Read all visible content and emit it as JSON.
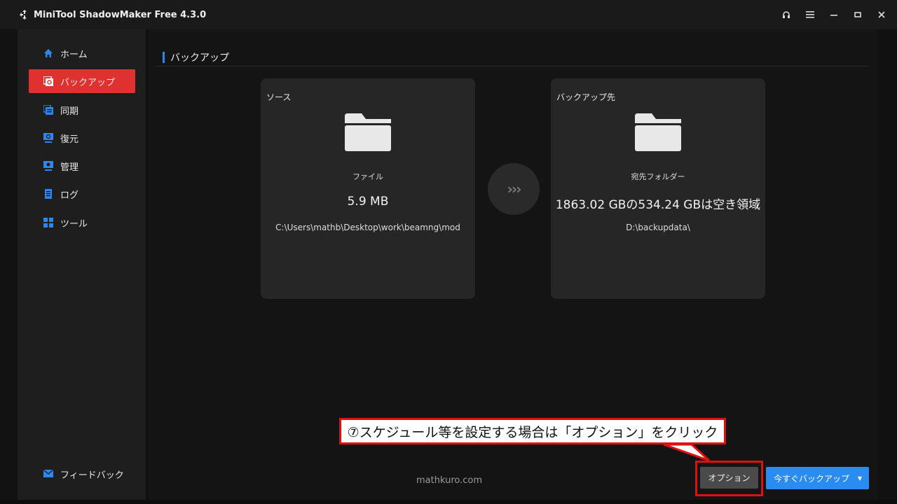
{
  "window": {
    "title": "MiniTool ShadowMaker Free 4.3.0",
    "controls": [
      "headset-icon",
      "menu-icon",
      "minimize-icon",
      "maximize-icon",
      "close-icon"
    ]
  },
  "sidebar": {
    "items": [
      {
        "label": "ホーム",
        "icon": "home-icon"
      },
      {
        "label": "バックアップ",
        "icon": "backup-icon",
        "active": true
      },
      {
        "label": "同期",
        "icon": "sync-icon"
      },
      {
        "label": "復元",
        "icon": "restore-icon"
      },
      {
        "label": "管理",
        "icon": "manage-icon"
      },
      {
        "label": "ログ",
        "icon": "log-icon"
      },
      {
        "label": "ツール",
        "icon": "tools-icon"
      }
    ],
    "feedback": "フィードバック"
  },
  "main": {
    "section_title": "バックアップ",
    "source": {
      "label": "ソース",
      "type": "ファイル",
      "size": "5.9 MB",
      "path": "C:\\Users\\mathb\\Desktop\\work\\beamng\\mod"
    },
    "destination": {
      "label": "バックアップ先",
      "type": "宛先フォルダー",
      "space": "1863.02 GBの534.24 GBは空き領域",
      "path": "D:\\backupdata\\"
    },
    "arrow_glyph": "›››",
    "annotation": "⑦スケジュール等を設定する場合は「オプション」をクリック",
    "watermark": "mathkuro.com",
    "buttons": {
      "options": "オプション",
      "backup_now": "今すぐバックアップ",
      "backup_dropdown": "▼"
    }
  },
  "colors": {
    "accent_red": "#e03131",
    "accent_blue": "#2a8cf0",
    "annotation_border": "#e01010"
  }
}
